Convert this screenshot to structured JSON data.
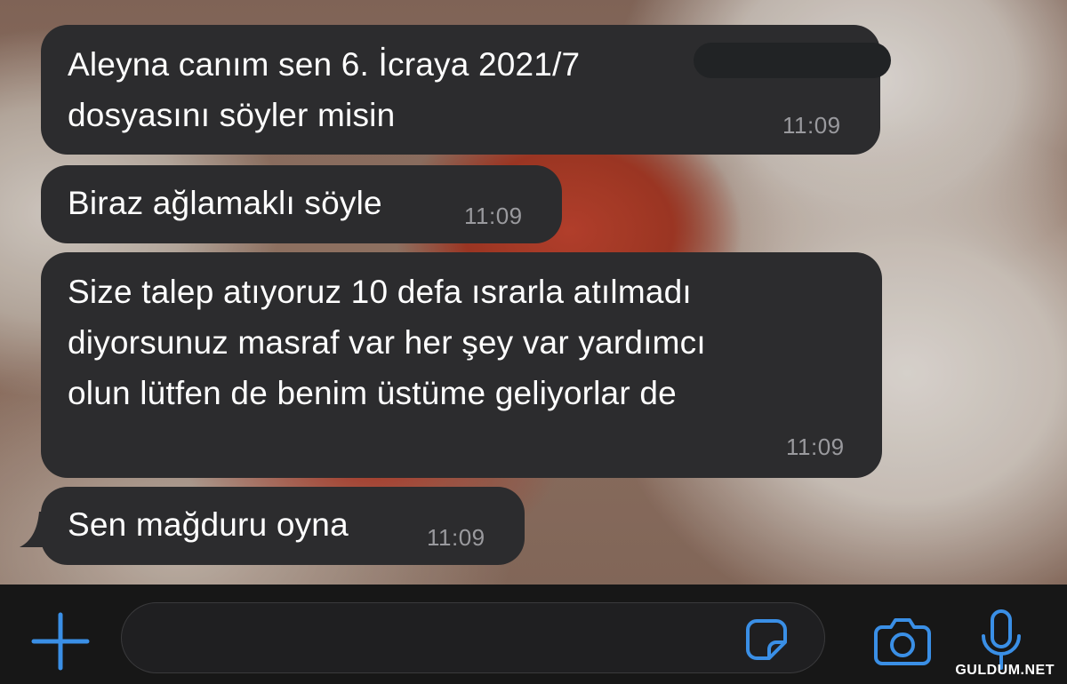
{
  "messages": [
    {
      "text": "Aleyna canım sen 6. İcraya 2021/7\ndosyasını söyler misin",
      "time": "11:09"
    },
    {
      "text": "Biraz ağlamaklı söyle",
      "time": "11:09"
    },
    {
      "text": "Size talep atıyoruz 10 defa ısrarla atılmadı\ndiyorsunuz masraf var her şey var yardımcı\nolun lütfen de benim üstüme geliyorlar de",
      "time": "11:09"
    },
    {
      "text": "Sen mağduru oyna",
      "time": "11:09"
    }
  ],
  "input": {
    "placeholder": ""
  },
  "watermark": "GULDUM.NET",
  "colors": {
    "bubble": "#2c2c2e",
    "accent": "#3a8fe6",
    "input_bar": "#171717"
  },
  "icons": {
    "add": "plus-icon",
    "sticker": "sticker-icon",
    "camera": "camera-icon",
    "mic": "microphone-icon"
  }
}
